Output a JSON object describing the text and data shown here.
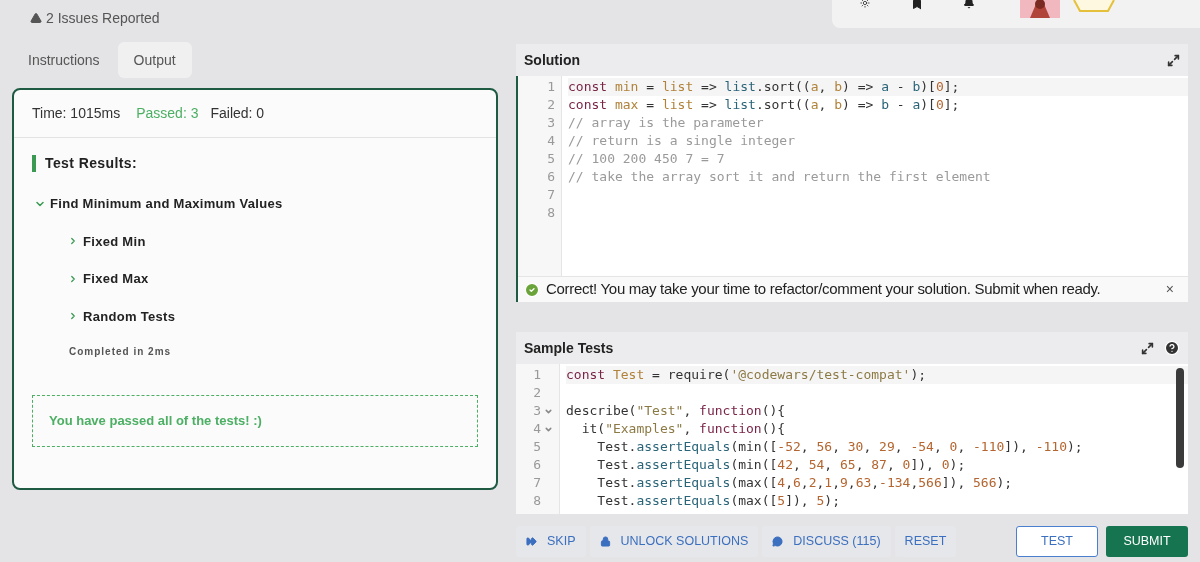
{
  "issues": {
    "label": "2 Issues Reported"
  },
  "tabs": [
    {
      "label": "Instructions",
      "selected": false
    },
    {
      "label": "Output",
      "selected": true
    }
  ],
  "output": {
    "time": "Time: 1015ms",
    "passed": "Passed: 3",
    "failed": "Failed: 0",
    "results_title": "Test Results:",
    "group": {
      "label": "Find Minimum and Maximum Values",
      "expanded": true,
      "children": [
        {
          "label": "Fixed Min",
          "expanded": false
        },
        {
          "label": "Fixed Max",
          "expanded": false
        },
        {
          "label": "Random Tests",
          "expanded": false
        }
      ],
      "completed": "Completed in 2ms"
    },
    "success": "You have passed all of the tests! :)"
  },
  "solution": {
    "title": "Solution",
    "lines": [
      {
        "number": "1",
        "tokens": [
          {
            "text": "const",
            "kind": "kw"
          },
          {
            "text": " min",
            "kind": "def"
          },
          {
            "text": " = ",
            "kind": "p"
          },
          {
            "text": "list",
            "kind": "def"
          },
          {
            "text": " => ",
            "kind": "p"
          },
          {
            "text": "list",
            "kind": "prop"
          },
          {
            "text": ".sort((",
            "kind": "p"
          },
          {
            "text": "a",
            "kind": "def"
          },
          {
            "text": ", ",
            "kind": "p"
          },
          {
            "text": "b",
            "kind": "def"
          },
          {
            "text": ") => ",
            "kind": "p"
          },
          {
            "text": "a",
            "kind": "prop"
          },
          {
            "text": " - ",
            "kind": "p"
          },
          {
            "text": "b",
            "kind": "prop"
          },
          {
            "text": ")[",
            "kind": "p"
          },
          {
            "text": "0",
            "kind": "num"
          },
          {
            "text": "];",
            "kind": "p"
          }
        ]
      },
      {
        "number": "2",
        "tokens": [
          {
            "text": "const",
            "kind": "kw"
          },
          {
            "text": " max",
            "kind": "def"
          },
          {
            "text": " = ",
            "kind": "p"
          },
          {
            "text": "list",
            "kind": "def"
          },
          {
            "text": " => ",
            "kind": "p"
          },
          {
            "text": "list",
            "kind": "prop"
          },
          {
            "text": ".sort((",
            "kind": "p"
          },
          {
            "text": "a",
            "kind": "def"
          },
          {
            "text": ", ",
            "kind": "p"
          },
          {
            "text": "b",
            "kind": "def"
          },
          {
            "text": ") => ",
            "kind": "p"
          },
          {
            "text": "b",
            "kind": "prop"
          },
          {
            "text": " - ",
            "kind": "p"
          },
          {
            "text": "a",
            "kind": "prop"
          },
          {
            "text": ")[",
            "kind": "p"
          },
          {
            "text": "0",
            "kind": "num"
          },
          {
            "text": "];",
            "kind": "p"
          }
        ]
      },
      {
        "number": "3",
        "tokens": [
          {
            "text": "// array is the parameter",
            "kind": "comment"
          }
        ]
      },
      {
        "number": "4",
        "tokens": [
          {
            "text": "// return is a single integer",
            "kind": "comment"
          }
        ]
      },
      {
        "number": "5",
        "tokens": [
          {
            "text": "// 100 200 450 7 = 7",
            "kind": "comment"
          }
        ]
      },
      {
        "number": "6",
        "tokens": [
          {
            "text": "// take the array sort it and return the first element",
            "kind": "comment"
          }
        ]
      },
      {
        "number": "7"
      },
      {
        "number": "8"
      }
    ],
    "notice": "Correct! You may take your time to refactor/comment your solution. Submit when ready.",
    "close": "×"
  },
  "sample_tests": {
    "title": "Sample Tests",
    "lines": [
      {
        "number": "1",
        "foldable": false,
        "tokens": [
          {
            "text": "const",
            "kind": "kw"
          },
          {
            "text": " Test",
            "kind": "def"
          },
          {
            "text": " = require(",
            "kind": "p"
          },
          {
            "text": "'@codewars/test-compat'",
            "kind": "str"
          },
          {
            "text": ");",
            "kind": "p"
          }
        ]
      },
      {
        "number": "2",
        "foldable": false
      },
      {
        "number": "3",
        "foldable": true,
        "tokens": [
          {
            "text": "describe(",
            "kind": "p"
          },
          {
            "text": "\"Test\"",
            "kind": "str"
          },
          {
            "text": ", ",
            "kind": "p"
          },
          {
            "text": "function",
            "kind": "kw"
          },
          {
            "text": "(){",
            "kind": "p"
          }
        ]
      },
      {
        "number": "4",
        "foldable": true,
        "tokens": [
          {
            "text": "  it(",
            "kind": "p"
          },
          {
            "text": "\"Examples\"",
            "kind": "str"
          },
          {
            "text": ", ",
            "kind": "p"
          },
          {
            "text": "function",
            "kind": "kw"
          },
          {
            "text": "(){",
            "kind": "p"
          }
        ]
      },
      {
        "number": "5",
        "foldable": false,
        "tokens": [
          {
            "text": "    Test.",
            "kind": "p"
          },
          {
            "text": "assertEquals",
            "kind": "prop"
          },
          {
            "text": "(min([",
            "kind": "p"
          },
          {
            "text": "-52",
            "kind": "num"
          },
          {
            "text": ", ",
            "kind": "p"
          },
          {
            "text": "56",
            "kind": "num"
          },
          {
            "text": ", ",
            "kind": "p"
          },
          {
            "text": "30",
            "kind": "num"
          },
          {
            "text": ", ",
            "kind": "p"
          },
          {
            "text": "29",
            "kind": "num"
          },
          {
            "text": ", ",
            "kind": "p"
          },
          {
            "text": "-54",
            "kind": "num"
          },
          {
            "text": ", ",
            "kind": "p"
          },
          {
            "text": "0",
            "kind": "num"
          },
          {
            "text": ", ",
            "kind": "p"
          },
          {
            "text": "-110",
            "kind": "num"
          },
          {
            "text": "]), ",
            "kind": "p"
          },
          {
            "text": "-110",
            "kind": "num"
          },
          {
            "text": ");",
            "kind": "p"
          }
        ]
      },
      {
        "number": "6",
        "foldable": false,
        "tokens": [
          {
            "text": "    Test.",
            "kind": "p"
          },
          {
            "text": "assertEquals",
            "kind": "prop"
          },
          {
            "text": "(min([",
            "kind": "p"
          },
          {
            "text": "42",
            "kind": "num"
          },
          {
            "text": ", ",
            "kind": "p"
          },
          {
            "text": "54",
            "kind": "num"
          },
          {
            "text": ", ",
            "kind": "p"
          },
          {
            "text": "65",
            "kind": "num"
          },
          {
            "text": ", ",
            "kind": "p"
          },
          {
            "text": "87",
            "kind": "num"
          },
          {
            "text": ", ",
            "kind": "p"
          },
          {
            "text": "0",
            "kind": "num"
          },
          {
            "text": "]), ",
            "kind": "p"
          },
          {
            "text": "0",
            "kind": "num"
          },
          {
            "text": ");",
            "kind": "p"
          }
        ]
      },
      {
        "number": "7",
        "foldable": false,
        "tokens": [
          {
            "text": "    Test.",
            "kind": "p"
          },
          {
            "text": "assertEquals",
            "kind": "prop"
          },
          {
            "text": "(max([",
            "kind": "p"
          },
          {
            "text": "4",
            "kind": "num"
          },
          {
            "text": ",",
            "kind": "p"
          },
          {
            "text": "6",
            "kind": "num"
          },
          {
            "text": ",",
            "kind": "p"
          },
          {
            "text": "2",
            "kind": "num"
          },
          {
            "text": ",",
            "kind": "p"
          },
          {
            "text": "1",
            "kind": "num"
          },
          {
            "text": ",",
            "kind": "p"
          },
          {
            "text": "9",
            "kind": "num"
          },
          {
            "text": ",",
            "kind": "p"
          },
          {
            "text": "63",
            "kind": "num"
          },
          {
            "text": ",",
            "kind": "p"
          },
          {
            "text": "-134",
            "kind": "num"
          },
          {
            "text": ",",
            "kind": "p"
          },
          {
            "text": "566",
            "kind": "num"
          },
          {
            "text": "]), ",
            "kind": "p"
          },
          {
            "text": "566",
            "kind": "num"
          },
          {
            "text": ");",
            "kind": "p"
          }
        ]
      },
      {
        "number": "8",
        "foldable": false,
        "tokens": [
          {
            "text": "    Test.",
            "kind": "p"
          },
          {
            "text": "assertEquals",
            "kind": "prop"
          },
          {
            "text": "(max([",
            "kind": "p"
          },
          {
            "text": "5",
            "kind": "num"
          },
          {
            "text": "]), ",
            "kind": "p"
          },
          {
            "text": "5",
            "kind": "num"
          },
          {
            "text": ");",
            "kind": "p"
          }
        ]
      }
    ]
  },
  "actions": [
    {
      "label": "SKIP",
      "kind": "skip"
    },
    {
      "label": "UNLOCK SOLUTIONS",
      "kind": "lock"
    },
    {
      "label": "DISCUSS (115)",
      "kind": "discuss"
    },
    {
      "label": "RESET",
      "kind": "plain"
    },
    {
      "label": "TEST",
      "kind": "outline"
    },
    {
      "label": "SUBMIT",
      "kind": "primary"
    }
  ]
}
